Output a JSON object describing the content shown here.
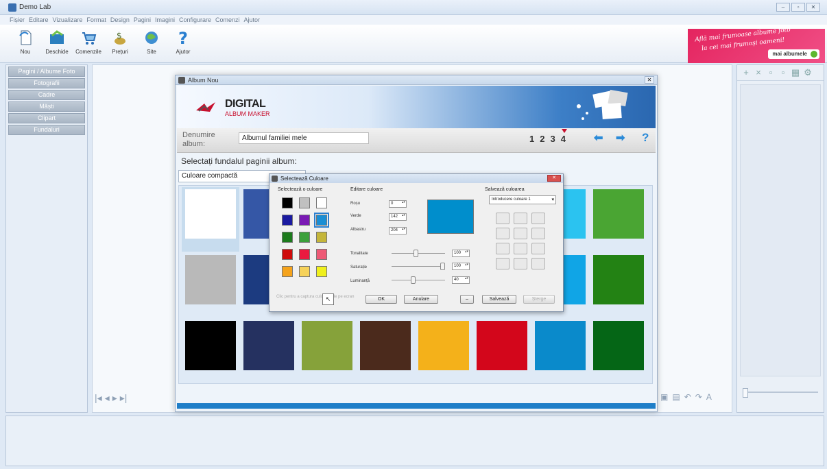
{
  "app": {
    "title": "Demo Lab",
    "window_buttons": [
      "–",
      "▫",
      "✕"
    ]
  },
  "menu": [
    "Fișier",
    "Editare",
    "Vizualizare",
    "Format",
    "Design",
    "Pagini",
    "Imagini",
    "Configurare",
    "Comenzi",
    "Ajutor"
  ],
  "toolbar": [
    {
      "label": "Nou",
      "icon": "new-icon"
    },
    {
      "label": "Deschide",
      "icon": "open-icon"
    },
    {
      "label": "Comenzile",
      "icon": "cart-icon"
    },
    {
      "label": "Prețuri",
      "icon": "prices-icon"
    },
    {
      "label": "Site",
      "icon": "website-icon"
    },
    {
      "label": "Ajutor",
      "icon": "help-icon"
    }
  ],
  "promo": {
    "line1": "Află mai frumoase albume foto",
    "line2": "la cei mai frumoși oameni!",
    "button": "mai albumele"
  },
  "left_panel": [
    "Pagini / Albume Foto",
    "Fotografii",
    "Cadre",
    "Măști",
    "Clipart",
    "Fundaluri"
  ],
  "album_dialog": {
    "title": "Album Nou",
    "close": "✕",
    "logo_big": "DIGITAL",
    "logo_small": "ALBUM MAKER",
    "name_label_1": "Denumire",
    "name_label_2": "album:",
    "name_value": "Albumul familiei mele",
    "steps": [
      "1",
      "2",
      "3",
      "4"
    ],
    "current_step": "4",
    "help": "?",
    "prompt": "Selectați fundalul paginii album:",
    "bg_type": "Culoare compactă",
    "swatches_row1": [
      "#ffffff",
      "#3557a6",
      "#3557a6",
      "#3557a6",
      "#3557a6",
      "#3557a6",
      "#2bc3f0",
      "#4aa533"
    ],
    "swatches_row2": [
      "#b9b9b9",
      "#1c3b80",
      "#1c3b80",
      "#1c3b80",
      "#1c3b80",
      "#1c3b80",
      "#10a5e6",
      "#238214"
    ],
    "swatches_row3": [
      "#000000",
      "#253160",
      "#86a23a",
      "#4b2a1c",
      "#f4b11a",
      "#d3061b",
      "#0a8acb",
      "#056616"
    ]
  },
  "color_dialog": {
    "title": "Selectează Culoare",
    "close": "✕",
    "section_select": "Selectează o culoare",
    "section_edit": "Editare culoare",
    "section_save": "Salvează culoarea",
    "palette": [
      "#000000",
      "#c0c0c0",
      "#ffffff",
      "#1a1aa0",
      "#7a1ab4",
      "#1a8ed4",
      "#1c7a1c",
      "#3ba03b",
      "#c5b63a",
      "#cf0b0b",
      "#ea1a40",
      "#ee5a76",
      "#f5a31c",
      "#f6d25a",
      "#f0f01c"
    ],
    "red_label": "Roșu",
    "green_label": "Verde",
    "blue_label": "Albastru",
    "red": "0",
    "green": "142",
    "blue": "204",
    "hue_label": "Tonalitate",
    "sat_label": "Saturație",
    "lum_label": "Luminanță",
    "hue": "100",
    "sat": "100",
    "lum": "40",
    "hue_level": 0.45,
    "sat_level": 1.0,
    "lum_level": 0.4,
    "preview_color": "#008ecc",
    "save_select": "Introducere culoare 1",
    "hint": "Clic pentru a captura culoarea de pe ecran",
    "ok": "OK",
    "cancel": "Anulare",
    "expand": "–",
    "save": "Salvează",
    "delete": "Șterge"
  }
}
